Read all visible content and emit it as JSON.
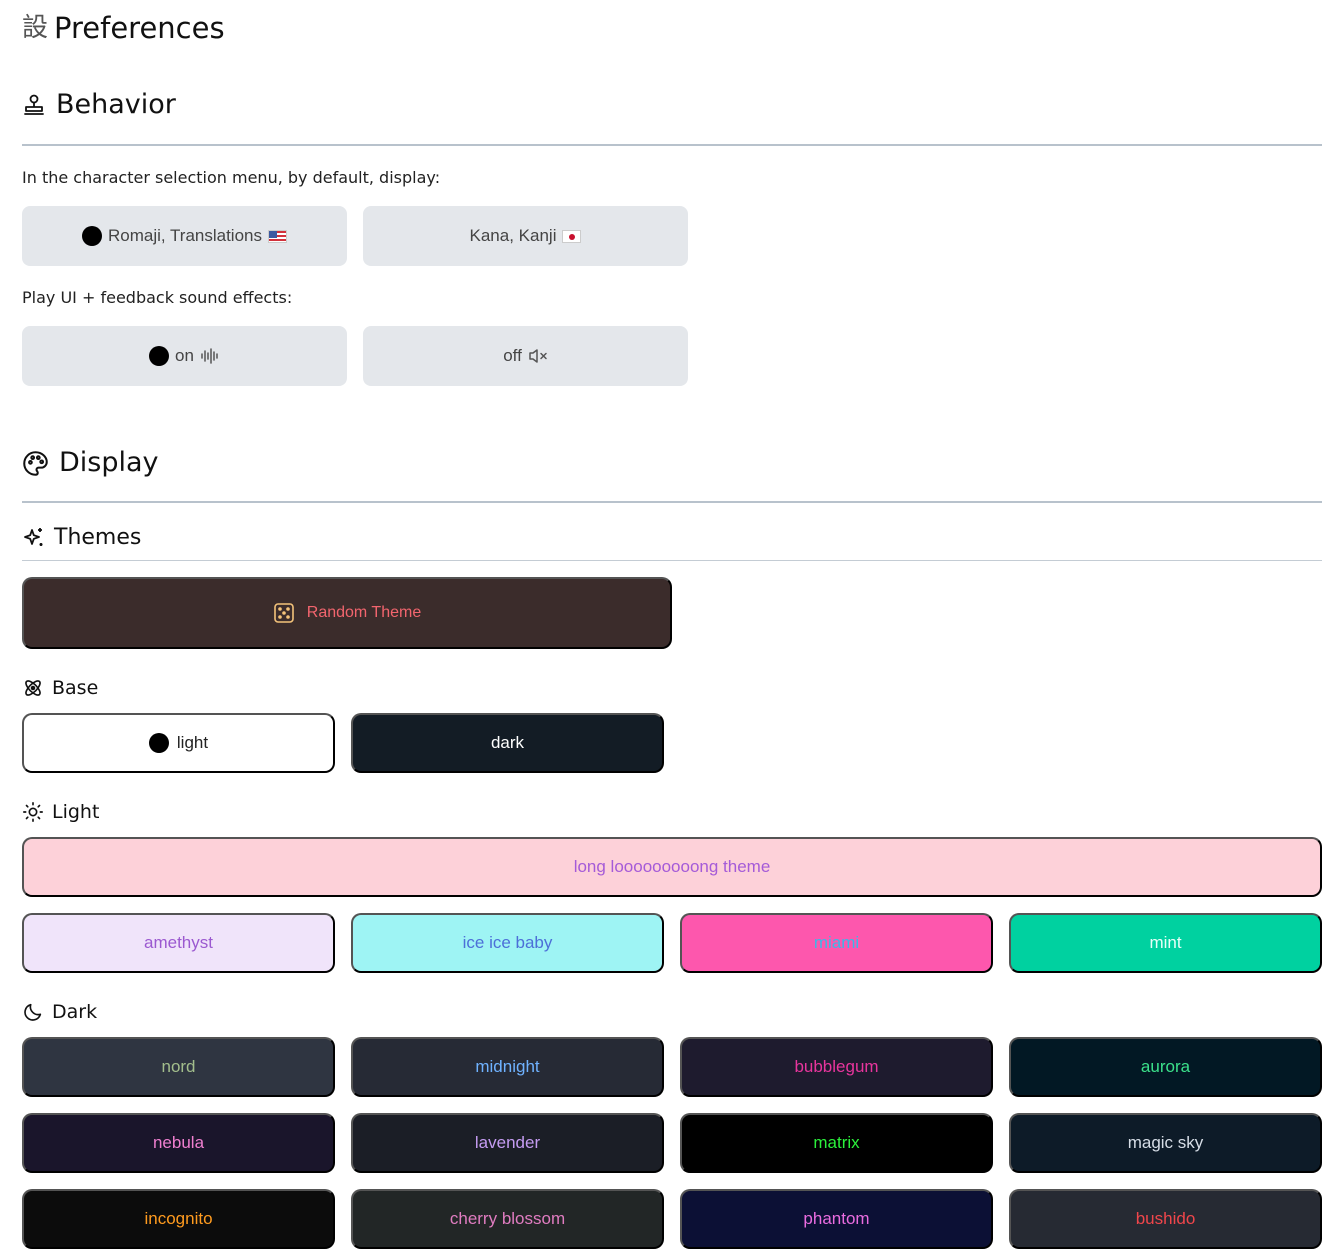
{
  "page": {
    "title": "Preferences",
    "title_icon": "設"
  },
  "behavior": {
    "title": "Behavior",
    "char_menu_label": "In the character selection menu, by default, display:",
    "char_options": [
      {
        "label": "Romaji, Translations",
        "selected": true,
        "icon": "flag-us-icon"
      },
      {
        "label": "Kana, Kanji",
        "selected": false,
        "icon": "flag-jp-icon"
      }
    ],
    "sound_label": "Play UI + feedback sound effects:",
    "sound_options": [
      {
        "label": "on",
        "selected": true,
        "icon": "audio-waveform-icon"
      },
      {
        "label": "off",
        "selected": false,
        "icon": "volume-mute-icon"
      }
    ]
  },
  "display": {
    "title": "Display",
    "themes": {
      "title": "Themes",
      "random_label": "Random Theme",
      "base": {
        "title": "Base",
        "options": [
          {
            "label": "light",
            "selected": true
          },
          {
            "label": "dark",
            "selected": false
          }
        ]
      },
      "light": {
        "title": "Light",
        "wide": {
          "label": "long looooooooong theme",
          "bg": "#fdd1d9",
          "fg": "#a55bd8"
        },
        "items": [
          {
            "label": "amethyst",
            "bg": "#f0e4fa",
            "fg": "#9b59d0"
          },
          {
            "label": "ice ice baby",
            "bg": "#9ef4f4",
            "fg": "#4c6fd8"
          },
          {
            "label": "miami",
            "bg": "#fd57ad",
            "fg": "#3bb8e8"
          },
          {
            "label": "mint",
            "bg": "#00d1a0",
            "fg": "#e8fff8"
          }
        ]
      },
      "dark": {
        "title": "Dark",
        "items": [
          {
            "label": "nord",
            "bg": "#2f3541",
            "fg": "#a3be8c"
          },
          {
            "label": "midnight",
            "bg": "#262a35",
            "fg": "#6fb2ff"
          },
          {
            "label": "bubblegum",
            "bg": "#1e1b2e",
            "fg": "#e8359d"
          },
          {
            "label": "aurora",
            "bg": "#021824",
            "fg": "#3be08a"
          },
          {
            "label": "nebula",
            "bg": "#1a152b",
            "fg": "#f07fd0"
          },
          {
            "label": "lavender",
            "bg": "#1b1e26",
            "fg": "#c59cf2"
          },
          {
            "label": "matrix",
            "bg": "#000000",
            "fg": "#2bf03b"
          },
          {
            "label": "magic sky",
            "bg": "#0d1b28",
            "fg": "#d6dde6"
          },
          {
            "label": "incognito",
            "bg": "#0c0c0c",
            "fg": "#ff9b1f"
          },
          {
            "label": "cherry blossom",
            "bg": "#222626",
            "fg": "#e07cc0"
          },
          {
            "label": "phantom",
            "bg": "#0c1035",
            "fg": "#ea6ce0"
          },
          {
            "label": "bushido",
            "bg": "#262a33",
            "fg": "#f0464b"
          }
        ]
      }
    }
  }
}
